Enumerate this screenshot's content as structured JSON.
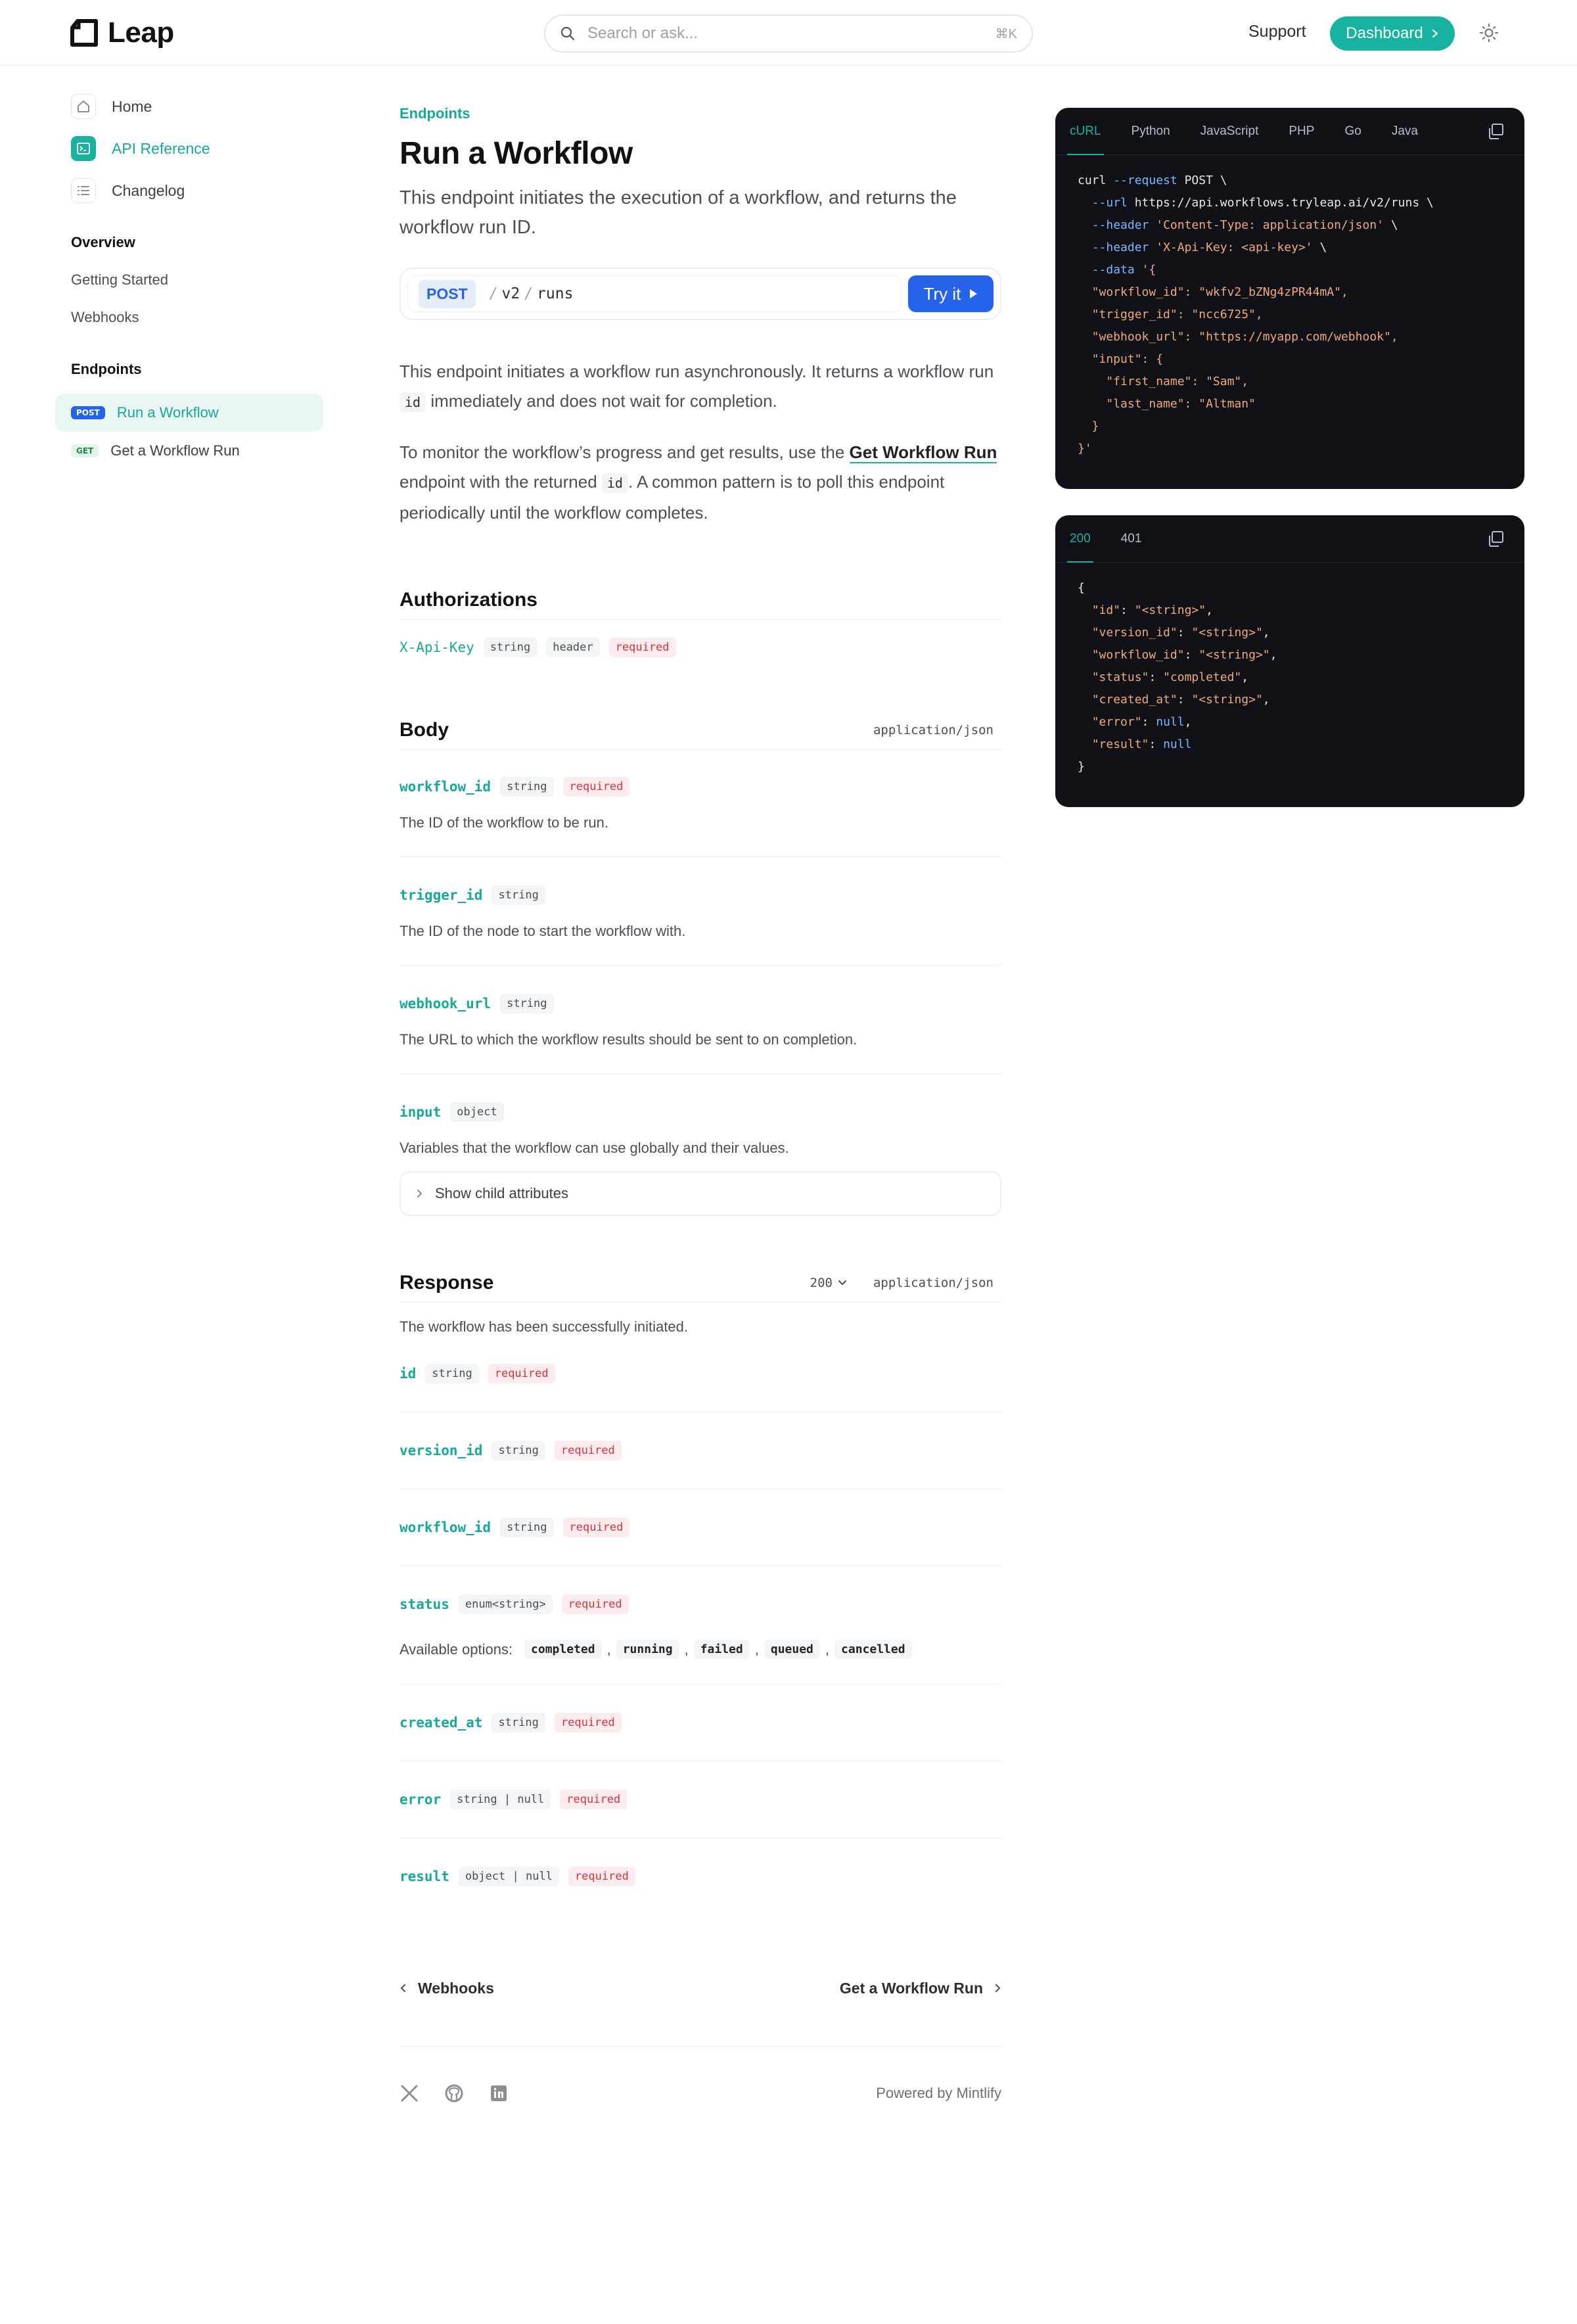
{
  "header": {
    "logo_text": "Leap",
    "search_placeholder": "Search or ask...",
    "search_shortcut": "⌘K",
    "support_label": "Support",
    "dashboard_label": "Dashboard"
  },
  "sidebar": {
    "top_items": [
      {
        "label": "Home",
        "icon": "home-icon",
        "active": false
      },
      {
        "label": "API Reference",
        "icon": "terminal-icon",
        "active": true
      },
      {
        "label": "Changelog",
        "icon": "list-icon",
        "active": false
      }
    ],
    "overview": {
      "title": "Overview",
      "links": [
        "Getting Started",
        "Webhooks"
      ]
    },
    "endpoints": {
      "title": "Endpoints",
      "items": [
        {
          "method": "POST",
          "label": "Run a Workflow",
          "active": true
        },
        {
          "method": "GET",
          "label": "Get a Workflow Run",
          "active": false
        }
      ]
    }
  },
  "main": {
    "eyebrow": "Endpoints",
    "title": "Run a Workflow",
    "subtitle": "This endpoint initiates the execution of a workflow, and returns the workflow run ID.",
    "endpoint": {
      "method": "POST",
      "path_segments": [
        "v2",
        "runs"
      ],
      "try_label": "Try it"
    },
    "para1": {
      "before": "This endpoint initiates a workflow run asynchronously. It returns a workflow run",
      "code": "id",
      "after": "immediately and does not wait for completion."
    },
    "para2": {
      "before": "To monitor the workflow’s progress and get results, use the",
      "link": "Get Workflow Run",
      "middle": "endpoint with the returned",
      "code": "id",
      "after": ". A common pattern is to poll this endpoint periodically until the workflow completes."
    },
    "authorizations": {
      "title": "Authorizations",
      "field": {
        "name": "X-Api-Key",
        "type": "string",
        "location": "header",
        "required": "required"
      }
    },
    "body": {
      "title": "Body",
      "content_type": "application/json",
      "fields": [
        {
          "name": "workflow_id",
          "type": "string",
          "required": "required",
          "desc": "The ID of the workflow to be run."
        },
        {
          "name": "trigger_id",
          "type": "string",
          "required": "",
          "desc": "The ID of the node to start the workflow with."
        },
        {
          "name": "webhook_url",
          "type": "string",
          "required": "",
          "desc": "The URL to which the workflow results should be sent to on completion."
        },
        {
          "name": "input",
          "type": "object",
          "required": "",
          "desc": "Variables that the workflow can use globally and their values."
        }
      ],
      "child_attributes_label": "Show child attributes"
    },
    "response": {
      "title": "Response",
      "status": "200",
      "content_type": "application/json",
      "desc": "The workflow has been successfully initiated.",
      "fields": [
        {
          "name": "id",
          "type": "string",
          "required": "required"
        },
        {
          "name": "version_id",
          "type": "string",
          "required": "required"
        },
        {
          "name": "workflow_id",
          "type": "string",
          "required": "required"
        },
        {
          "name": "status",
          "type": "enum<string>",
          "required": "required"
        },
        {
          "name": "created_at",
          "type": "string",
          "required": "required"
        },
        {
          "name": "error",
          "type": "string | null",
          "required": "required"
        },
        {
          "name": "result",
          "type": "object | null",
          "required": "required"
        }
      ],
      "options_label": "Available options:",
      "options": [
        "completed",
        "running",
        "failed",
        "queued",
        "cancelled"
      ]
    },
    "pager": {
      "prev": "Webhooks",
      "next": "Get a Workflow Run"
    },
    "footer": {
      "powered_by": "Powered by Mintlify"
    }
  },
  "request_panel": {
    "tabs": [
      "cURL",
      "Python",
      "JavaScript",
      "PHP",
      "Go",
      "Java"
    ],
    "active_tab": "cURL",
    "lines": [
      [
        [
          "plain",
          "curl "
        ],
        [
          "kw",
          "--request"
        ],
        [
          "plain",
          " POST \\"
        ]
      ],
      [
        [
          "plain",
          "  "
        ],
        [
          "kw",
          "--url"
        ],
        [
          "plain",
          " https://api.workflows.tryleap.ai/v2/runs \\"
        ]
      ],
      [
        [
          "plain",
          "  "
        ],
        [
          "kw",
          "--header"
        ],
        [
          "plain",
          " "
        ],
        [
          "str",
          "'Content-Type: application/json'"
        ],
        [
          "plain",
          " \\"
        ]
      ],
      [
        [
          "plain",
          "  "
        ],
        [
          "kw",
          "--header"
        ],
        [
          "plain",
          " "
        ],
        [
          "str",
          "'X-Api-Key: <api-key>'"
        ],
        [
          "plain",
          " \\"
        ]
      ],
      [
        [
          "plain",
          "  "
        ],
        [
          "kw",
          "--data"
        ],
        [
          "plain",
          " "
        ],
        [
          "str",
          "'{"
        ]
      ],
      [
        [
          "str",
          "  \"workflow_id\": \"wkfv2_bZNg4zPR44mA\","
        ]
      ],
      [
        [
          "str",
          "  \"trigger_id\": \"ncc6725\","
        ]
      ],
      [
        [
          "str",
          "  \"webhook_url\": \"https://myapp.com/webhook\","
        ]
      ],
      [
        [
          "str",
          "  \"input\": {"
        ]
      ],
      [
        [
          "str",
          "    \"first_name\": \"Sam\","
        ]
      ],
      [
        [
          "str",
          "    \"last_name\": \"Altman\""
        ]
      ],
      [
        [
          "str",
          "  }"
        ]
      ],
      [
        [
          "str",
          "}'"
        ]
      ]
    ]
  },
  "response_panel": {
    "tabs": [
      "200",
      "401"
    ],
    "active_tab": "200",
    "lines": [
      [
        [
          "plain",
          "{"
        ]
      ],
      [
        [
          "plain",
          "  "
        ],
        [
          "key",
          "\"id\""
        ],
        [
          "plain",
          ": "
        ],
        [
          "str",
          "\"<string>\""
        ],
        [
          "plain",
          ","
        ]
      ],
      [
        [
          "plain",
          "  "
        ],
        [
          "key",
          "\"version_id\""
        ],
        [
          "plain",
          ": "
        ],
        [
          "str",
          "\"<string>\""
        ],
        [
          "plain",
          ","
        ]
      ],
      [
        [
          "plain",
          "  "
        ],
        [
          "key",
          "\"workflow_id\""
        ],
        [
          "plain",
          ": "
        ],
        [
          "str",
          "\"<string>\""
        ],
        [
          "plain",
          ","
        ]
      ],
      [
        [
          "plain",
          "  "
        ],
        [
          "key",
          "\"status\""
        ],
        [
          "plain",
          ": "
        ],
        [
          "str",
          "\"completed\""
        ],
        [
          "plain",
          ","
        ]
      ],
      [
        [
          "plain",
          "  "
        ],
        [
          "key",
          "\"created_at\""
        ],
        [
          "plain",
          ": "
        ],
        [
          "str",
          "\"<string>\""
        ],
        [
          "plain",
          ","
        ]
      ],
      [
        [
          "plain",
          "  "
        ],
        [
          "key",
          "\"error\""
        ],
        [
          "plain",
          ": "
        ],
        [
          "null",
          "null"
        ],
        [
          "plain",
          ","
        ]
      ],
      [
        [
          "plain",
          "  "
        ],
        [
          "key",
          "\"result\""
        ],
        [
          "plain",
          ": "
        ],
        [
          "null",
          "null"
        ]
      ],
      [
        [
          "plain",
          "}"
        ]
      ]
    ]
  },
  "colors": {
    "accent": "#17b3a0",
    "primary_blue": "#2563eb",
    "required_red": "#d7323f",
    "code_bg": "#0f1117"
  }
}
